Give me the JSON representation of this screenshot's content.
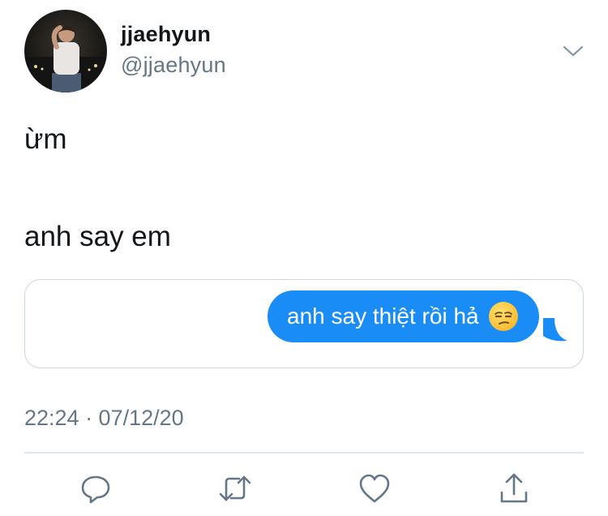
{
  "author": {
    "display_name": "jjaehyun",
    "handle": "@jjaehyun"
  },
  "tweet": {
    "lines": [
      "ừm",
      "anh say em"
    ],
    "attached_message": {
      "text": "anh say thiệt rồi hả",
      "emoji": "unamused-face-emoji",
      "bubble_color": "#1a8cf6"
    },
    "timestamp": "22:24 · 07/12/20"
  },
  "actions": [
    {
      "name": "reply",
      "icon": "reply-icon"
    },
    {
      "name": "retweet",
      "icon": "retweet-icon"
    },
    {
      "name": "like",
      "icon": "heart-icon"
    },
    {
      "name": "share",
      "icon": "share-icon"
    }
  ],
  "colors": {
    "primary_text": "#14171a",
    "secondary_text": "#657786",
    "accent": "#1da1f2"
  }
}
